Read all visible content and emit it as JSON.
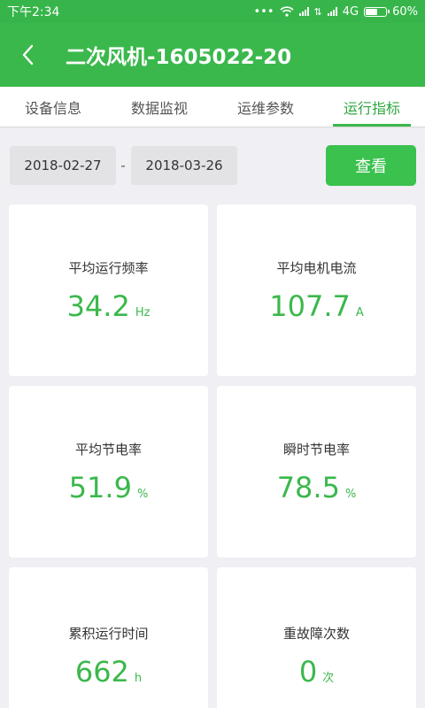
{
  "status": {
    "time": "下午2:34",
    "network": "4G",
    "battery": "60%",
    "battery_level": 0.6
  },
  "header": {
    "title": "二次风机-1605022-20"
  },
  "tabs": [
    {
      "label": "设备信息"
    },
    {
      "label": "数据监视"
    },
    {
      "label": "运维参数"
    },
    {
      "label": "运行指标"
    }
  ],
  "active_tab": 3,
  "date_range": {
    "start": "2018-02-27",
    "separator": "-",
    "end": "2018-03-26",
    "view_label": "查看"
  },
  "metrics": [
    {
      "label": "平均运行频率",
      "value": "34.2",
      "unit": "Hz"
    },
    {
      "label": "平均电机电流",
      "value": "107.7",
      "unit": "A"
    },
    {
      "label": "平均节电率",
      "value": "51.9",
      "unit": "%"
    },
    {
      "label": "瞬时节电率",
      "value": "78.5",
      "unit": "%"
    },
    {
      "label": "累积运行时间",
      "value": "662",
      "unit": "h"
    },
    {
      "label": "重故障次数",
      "value": "0",
      "unit": "次"
    }
  ],
  "colors": {
    "accent": "#3bb84c",
    "statusbar": "#37b54a",
    "background": "#efeff4"
  },
  "icons": {
    "back": "chevron-left-icon"
  }
}
